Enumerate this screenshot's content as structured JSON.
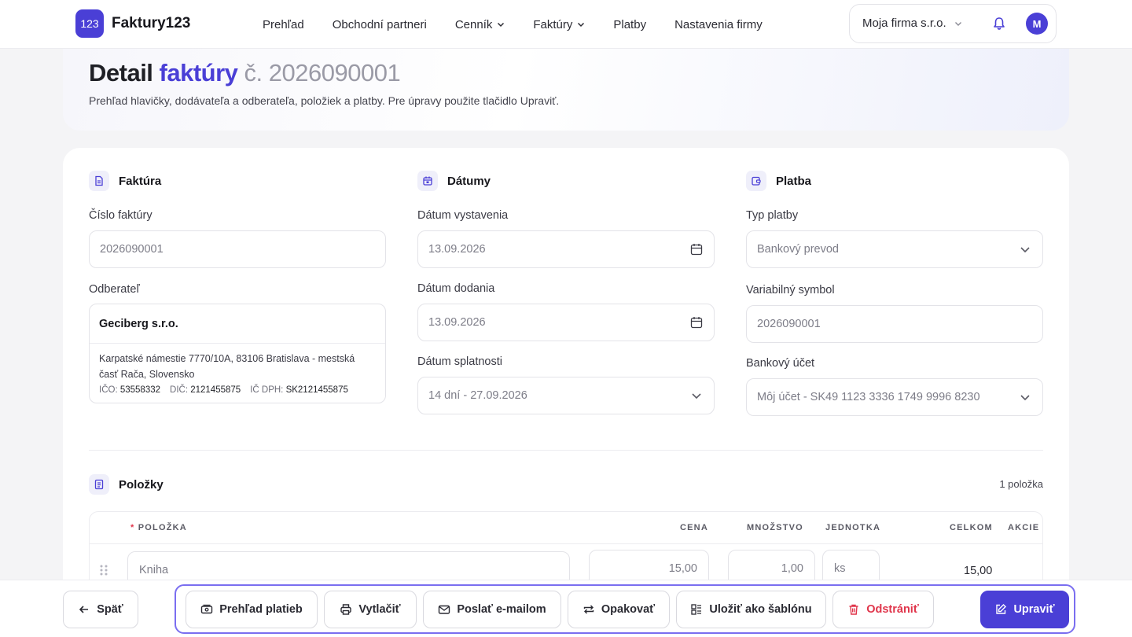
{
  "app": {
    "logo_mark": "123",
    "name": "Faktury123"
  },
  "nav": {
    "items": [
      {
        "label": "Prehľad",
        "dropdown": false
      },
      {
        "label": "Obchodní partneri",
        "dropdown": false
      },
      {
        "label": "Cenník",
        "dropdown": true
      },
      {
        "label": "Faktúry",
        "dropdown": true
      },
      {
        "label": "Platby",
        "dropdown": false
      },
      {
        "label": "Nastavenia firmy",
        "dropdown": false
      }
    ],
    "company": "Moja firma s.r.o.",
    "avatar_initial": "M"
  },
  "header": {
    "title_a": "Detail",
    "title_b": "faktúry",
    "title_c": "č. 2026090001",
    "subtitle": "Prehľad hlavičky, dodávateľa a odberateľa, položiek a platby. Pre úpravy použite tlačidlo Upraviť."
  },
  "invoice": {
    "section_title": "Faktúra",
    "number_label": "Číslo faktúry",
    "number_value": "2026090001",
    "client_label": "Odberateľ",
    "client_name": "Geciberg s.r.o.",
    "client_address": "Karpatské námestie 7770/10A, 83106 Bratislava - mestská časť Rača, Slovensko",
    "ico_label": "IČO:",
    "ico": "53558332",
    "dic_label": "DIČ:",
    "dic": "2121455875",
    "icdph_label": "IČ DPH:",
    "icdph": "SK2121455875"
  },
  "dates": {
    "section_title": "Dátumy",
    "issue_label": "Dátum vystavenia",
    "issue_value": "13.09.2026",
    "delivery_label": "Dátum dodania",
    "delivery_value": "13.09.2026",
    "due_label": "Dátum splatnosti",
    "due_value": "14 dní - 27.09.2026"
  },
  "payment": {
    "section_title": "Platba",
    "type_label": "Typ platby",
    "type_value": "Bankový prevod",
    "vs_label": "Variabilný symbol",
    "vs_value": "2026090001",
    "account_label": "Bankový účet",
    "account_value": "Môj účet - SK49 1123 3336 1749 9996 8230"
  },
  "items": {
    "section_title": "Položky",
    "count": "1 položka",
    "columns": {
      "item": "POLOŽKA",
      "price": "CENA",
      "qty": "MNOŽSTVO",
      "unit": "JEDNOTKA",
      "total": "CELKOM",
      "actions": "AKCIE"
    },
    "required_mark": "*",
    "rows": [
      {
        "name": "Kniha",
        "price": "15,00",
        "qty": "1,00",
        "unit": "ks",
        "total": "15,00"
      }
    ]
  },
  "actions": {
    "back": "Späť",
    "payments": "Prehľad platieb",
    "print": "Vytlačiť",
    "email": "Poslať e-mailom",
    "repeat": "Opakovať",
    "template": "Uložiť ako šablónu",
    "delete": "Odstrániť",
    "edit": "Upraviť"
  },
  "colors": {
    "accent": "#4a3fd6",
    "danger": "#e0354b"
  }
}
